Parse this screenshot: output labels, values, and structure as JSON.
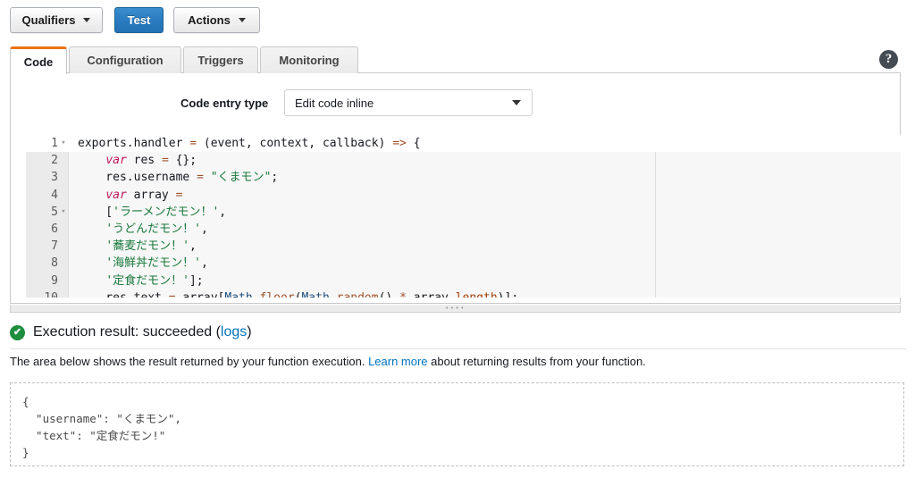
{
  "toolbar": {
    "qualifiers_label": "Qualifiers",
    "test_label": "Test",
    "actions_label": "Actions"
  },
  "tabs": [
    {
      "label": "Code",
      "active": true
    },
    {
      "label": "Configuration",
      "active": false
    },
    {
      "label": "Triggers",
      "active": false
    },
    {
      "label": "Monitoring",
      "active": false
    }
  ],
  "help": {
    "glyph": "?"
  },
  "code_entry": {
    "label": "Code entry type",
    "selected": "Edit code inline"
  },
  "editor": {
    "lines": [
      {
        "num": "1",
        "fold": "▾",
        "text": "exports.handler = (event, context, callback) => {",
        "current": true
      },
      {
        "num": "2",
        "fold": "",
        "text": "    var res = {};",
        "current": false
      },
      {
        "num": "3",
        "fold": "",
        "text": "    res.username = \"くまモン\";",
        "current": false
      },
      {
        "num": "4",
        "fold": "",
        "text": "    var array =",
        "current": false
      },
      {
        "num": "5",
        "fold": "▾",
        "text": "    ['ラーメンだモン！',",
        "current": false
      },
      {
        "num": "6",
        "fold": "",
        "text": "    'うどんだモン！',",
        "current": false
      },
      {
        "num": "7",
        "fold": "",
        "text": "    '蕎麦だモン！',",
        "current": false
      },
      {
        "num": "8",
        "fold": "",
        "text": "    '海鮮丼だモン！',",
        "current": false
      },
      {
        "num": "9",
        "fold": "",
        "text": "    '定食だモン！'];",
        "current": false
      },
      {
        "num": "10",
        "fold": "",
        "text": "    res.text = array[Math.floor(Math.random() * array.length)];",
        "current": false
      }
    ]
  },
  "execution": {
    "status_icon": "✔",
    "title_prefix": "Execution result: succeeded (",
    "logs_link": "logs",
    "title_suffix": ")",
    "desc_before": "The area below shows the result returned by your function execution. ",
    "desc_link": "Learn more",
    "desc_after": " about returning results from your function.",
    "result_json": "{\n  \"username\": \"くまモン\",\n  \"text\": \"定食だモン!\"\n}"
  },
  "colors": {
    "accent_orange": "#ec7211",
    "primary_blue": "#2272b5",
    "link_blue": "#0073bb",
    "success_green": "#1e8e3e"
  }
}
